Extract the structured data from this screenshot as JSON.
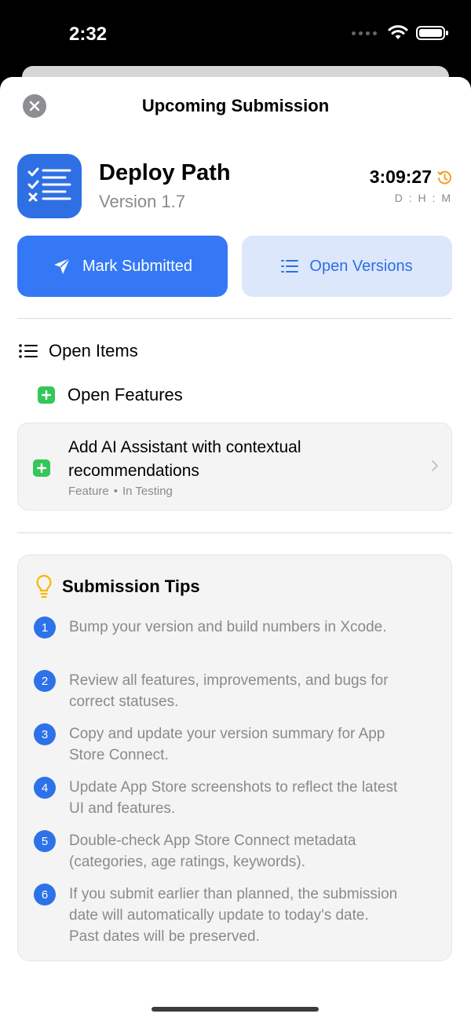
{
  "status_bar": {
    "time": "2:32"
  },
  "sheet": {
    "title": "Upcoming Submission"
  },
  "app": {
    "name": "Deploy Path",
    "version": "Version 1.7"
  },
  "countdown": {
    "value": "3:09:27",
    "units": "D : H : M"
  },
  "actions": {
    "primary_label": "Mark Submitted",
    "secondary_label": "Open Versions"
  },
  "open_items": {
    "header": "Open Items",
    "features_header": "Open Features",
    "items": [
      {
        "title": "Add AI Assistant with contextual recommendations",
        "type": "Feature",
        "separator": "•",
        "status": "In Testing"
      }
    ]
  },
  "tips": {
    "title": "Submission Tips",
    "items": [
      {
        "num": "1",
        "text": "Bump your version and build numbers in Xcode."
      },
      {
        "num": "2",
        "text": "Review all features, improvements, and bugs for correct statuses."
      },
      {
        "num": "3",
        "text": "Copy and update your version summary for App Store Connect."
      },
      {
        "num": "4",
        "text": "Update App Store screenshots to reflect the latest UI and features."
      },
      {
        "num": "5",
        "text": "Double-check App Store Connect metadata (categories, age ratings, keywords)."
      },
      {
        "num": "6",
        "text": "If you submit earlier than planned, the submission date will automatically update to today's date. Past dates will be preserved."
      }
    ]
  },
  "colors": {
    "accent": "#3478f6",
    "accent_light": "#dce7fb",
    "green": "#34c759",
    "tip_number": "#2d72e8",
    "clock_orange": "#f0a020"
  },
  "icons": [
    "close-icon",
    "checklist-icon",
    "history-clock-icon",
    "paper-plane-icon",
    "list-icon",
    "plus-icon",
    "chevron-right-icon",
    "lightbulb-icon"
  ]
}
